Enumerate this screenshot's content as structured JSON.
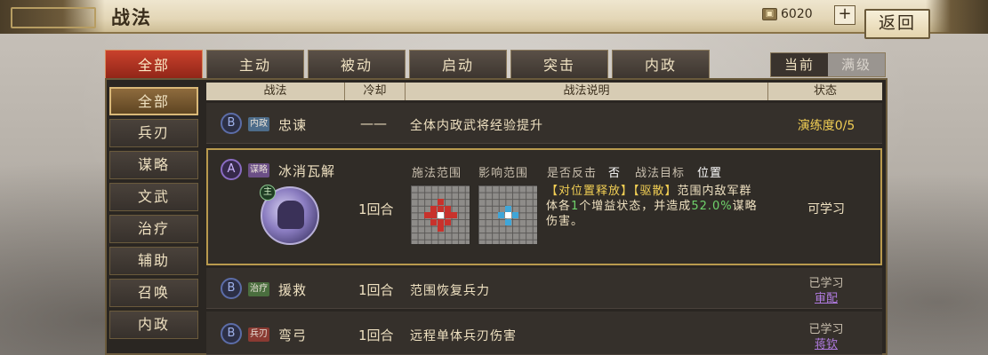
{
  "header": {
    "title": "战法",
    "currency_value": "6020",
    "plus_label": "+",
    "back_label": "返回"
  },
  "top_tabs": [
    {
      "label": "全部"
    },
    {
      "label": "主动"
    },
    {
      "label": "被动"
    },
    {
      "label": "启动"
    },
    {
      "label": "突击"
    },
    {
      "label": "内政"
    }
  ],
  "level_toggle": {
    "current": "当前",
    "max": "满级"
  },
  "sidebar": [
    {
      "label": "全部"
    },
    {
      "label": "兵刃"
    },
    {
      "label": "谋略"
    },
    {
      "label": "文武"
    },
    {
      "label": "治疗"
    },
    {
      "label": "辅助"
    },
    {
      "label": "召唤"
    },
    {
      "label": "内政"
    }
  ],
  "table": {
    "headers": [
      "战法",
      "冷却",
      "战法说明",
      "状态"
    ],
    "rows": [
      {
        "grade": "B",
        "type": "内政",
        "name": "忠谏",
        "cooldown": "——",
        "desc": "全体内政武将经验提升",
        "status": "演练度0/5"
      },
      {
        "grade": "A",
        "type": "谋略",
        "name": "冰消瓦解",
        "cooldown": "1回合",
        "labels": {
          "cast_range": "施法范围",
          "effect_range": "影响范围",
          "counter": "是否反击",
          "counter_value": "否",
          "target_label": "战法目标",
          "target_value": "位置"
        },
        "desc_parts": {
          "tag1": "【对位置释放】",
          "tag2": "【驱散】",
          "line1_rest": "范围内敌军群",
          "line2_a": "体各",
          "num1": "1",
          "line2_b": "个增益状态，并造成",
          "pct": "52.0%",
          "line2_c": "谋略",
          "line3": "伤害。"
        },
        "badge": "主",
        "status": "可学习"
      },
      {
        "grade": "B",
        "type": "治疗",
        "name": "援救",
        "cooldown": "1回合",
        "desc": "范围恢复兵力",
        "status": "已学习",
        "status_sub": "审配"
      },
      {
        "grade": "B",
        "type": "兵刃",
        "name": "弯弓",
        "cooldown": "1回合",
        "desc": "远程单体兵刃伤害",
        "status": "已学习",
        "status_sub": "蒋钦"
      }
    ]
  },
  "colors": {
    "active_tab": "#c9412c",
    "status_yellow": "#f2cf54",
    "learned_purple": "#b07be0",
    "range_red": "#c8322c",
    "range_blue": "#3fa6d8"
  }
}
